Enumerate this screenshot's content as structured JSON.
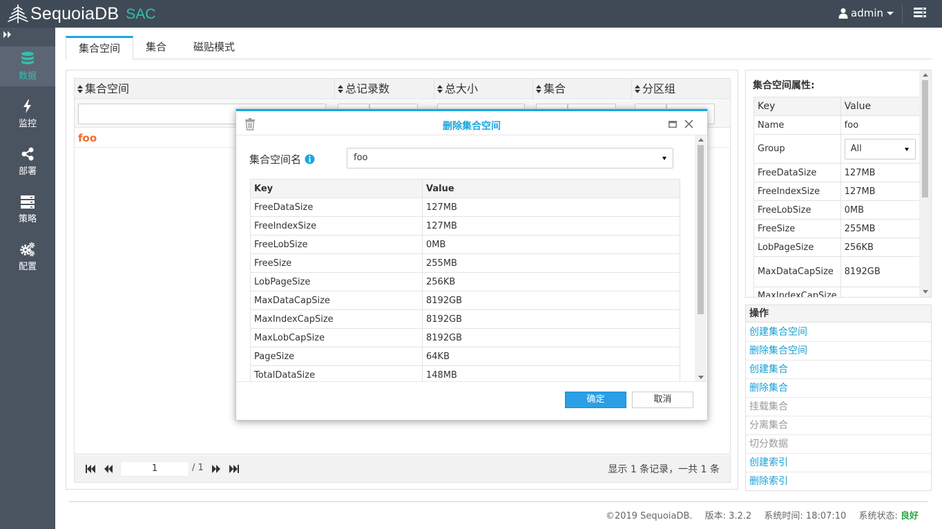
{
  "app": {
    "brand": "SequoiaDB",
    "product": "SAC",
    "user": "admin",
    "colors": {
      "header": "#3f4a56",
      "sidebar": "#4a5360",
      "accent": "#2fc1ad",
      "link": "#1aa0d6",
      "highlight": "#ef6b2c",
      "primary_button": "#2a9fe5"
    }
  },
  "sidebar": {
    "items": [
      {
        "label": "数据",
        "icon": "database-icon",
        "active": true
      },
      {
        "label": "监控",
        "icon": "bolt-icon",
        "active": false
      },
      {
        "label": "部署",
        "icon": "share-icon",
        "active": false
      },
      {
        "label": "策略",
        "icon": "server-icon",
        "active": false
      },
      {
        "label": "配置",
        "icon": "gears-icon",
        "active": false
      }
    ]
  },
  "tabs": [
    {
      "label": "集合空间",
      "active": true
    },
    {
      "label": "集合",
      "active": false
    },
    {
      "label": "磁贴模式",
      "active": false
    }
  ],
  "grid": {
    "columns": [
      "集合空间",
      "总记录数",
      "总大小",
      "集合",
      "分区组"
    ],
    "rows": [
      {
        "name": "foo"
      }
    ]
  },
  "pager": {
    "page": "1",
    "total": "/ 1",
    "record_info": "显示 1 条记录，一共 1 条"
  },
  "properties": {
    "title": "集合空间属性:",
    "header_key": "Key",
    "header_value": "Value",
    "rows": [
      {
        "key": "Name",
        "value": "foo"
      },
      {
        "key": "Group",
        "value": "All"
      },
      {
        "key": "FreeDataSize",
        "value": "127MB"
      },
      {
        "key": "FreeIndexSize",
        "value": "127MB"
      },
      {
        "key": "FreeLobSize",
        "value": "0MB"
      },
      {
        "key": "FreeSize",
        "value": "255MB"
      },
      {
        "key": "LobPageSize",
        "value": "256KB"
      },
      {
        "key": "MaxDataCapSize",
        "value": "8192GB"
      },
      {
        "key": "MaxIndexCapSize",
        "value": ""
      }
    ]
  },
  "operations": {
    "title": "操作",
    "items": [
      {
        "label": "创建集合空间",
        "enabled": true
      },
      {
        "label": "删除集合空间",
        "enabled": true
      },
      {
        "label": "创建集合",
        "enabled": true
      },
      {
        "label": "删除集合",
        "enabled": true
      },
      {
        "label": "挂载集合",
        "enabled": false
      },
      {
        "label": "分离集合",
        "enabled": false
      },
      {
        "label": "切分数据",
        "enabled": false
      },
      {
        "label": "创建索引",
        "enabled": true
      },
      {
        "label": "删除索引",
        "enabled": true
      }
    ]
  },
  "dialog": {
    "title": "删除集合空间",
    "field_label": "集合空间名",
    "selected": "foo",
    "table_key": "Key",
    "table_value": "Value",
    "rows": [
      {
        "key": "FreeDataSize",
        "value": "127MB"
      },
      {
        "key": "FreeIndexSize",
        "value": "127MB"
      },
      {
        "key": "FreeLobSize",
        "value": "0MB"
      },
      {
        "key": "FreeSize",
        "value": "255MB"
      },
      {
        "key": "LobPageSize",
        "value": "256KB"
      },
      {
        "key": "MaxDataCapSize",
        "value": "8192GB"
      },
      {
        "key": "MaxIndexCapSize",
        "value": "8192GB"
      },
      {
        "key": "MaxLobCapSize",
        "value": "8192GB"
      },
      {
        "key": "PageSize",
        "value": "64KB"
      },
      {
        "key": "TotalDataSize",
        "value": "148MB"
      }
    ],
    "ok_label": "确定",
    "cancel_label": "取消"
  },
  "footer": {
    "copyright": "©2019 SequoiaDB.",
    "version": "版本: 3.2.2",
    "time": "系统时间: 18:07:10",
    "status_label": "系统状态:",
    "status_value": "良好"
  }
}
